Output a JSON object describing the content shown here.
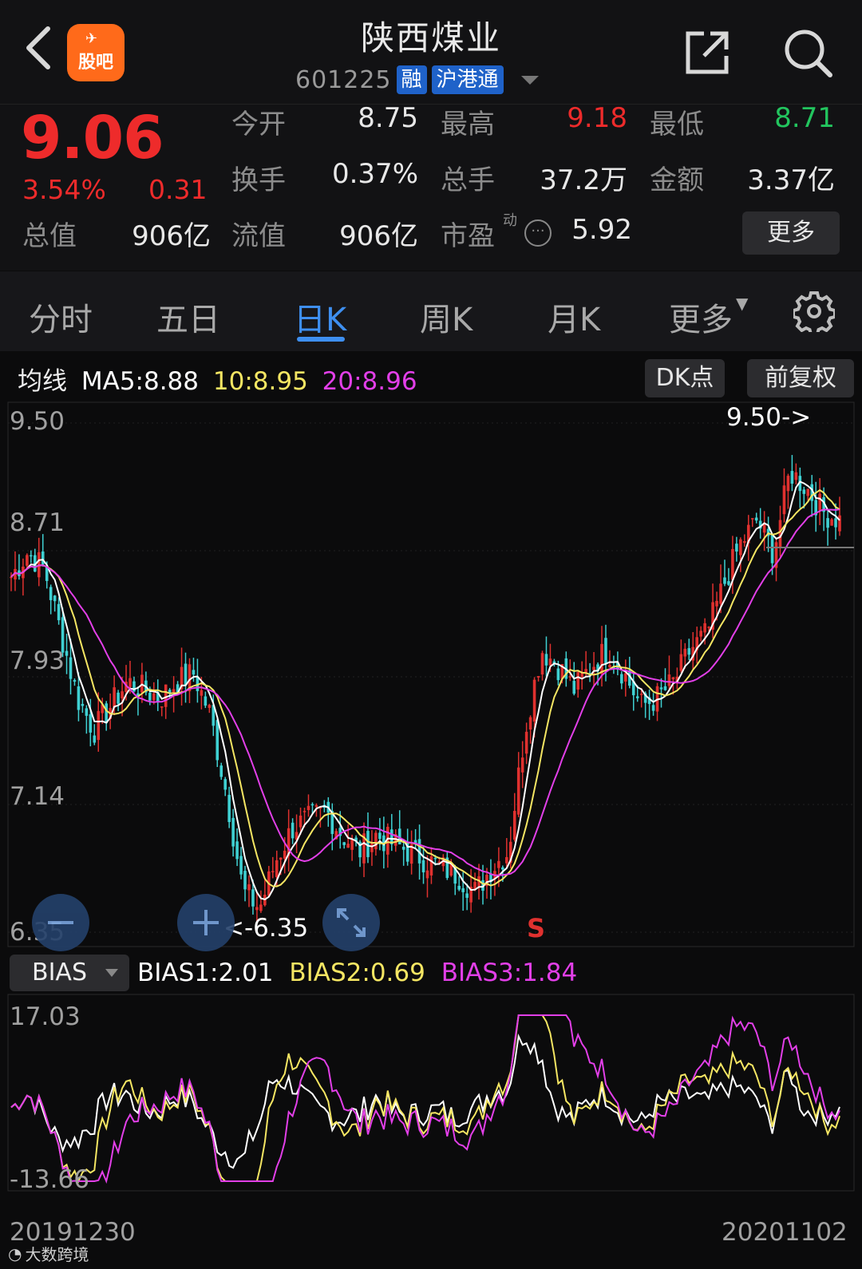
{
  "header": {
    "back_icon": "chevron-left-icon",
    "logo_text": "股吧",
    "stock_name": "陕西煤业",
    "stock_code": "601225",
    "tags": [
      "融",
      "沪港通"
    ],
    "share_icon": "share-icon",
    "search_icon": "search-icon"
  },
  "quote": {
    "price": "9.06",
    "change_pct": "3.54%",
    "change": "0.31",
    "rows": [
      [
        {
          "label": "今开",
          "value": "8.75",
          "color": "#e8e8e8"
        },
        {
          "label": "最高",
          "value": "9.18",
          "color": "#ee2b2b"
        },
        {
          "label": "最低",
          "value": "8.71",
          "color": "#22c55e"
        }
      ],
      [
        {
          "label": "换手",
          "value": "0.37%",
          "color": "#e8e8e8"
        },
        {
          "label": "总手",
          "value": "37.2万",
          "color": "#e8e8e8"
        },
        {
          "label": "金额",
          "value": "3.37亿",
          "color": "#e8e8e8"
        }
      ]
    ],
    "total_value_label": "总值",
    "total_value": "906亿",
    "float_value_label": "流值",
    "float_value": "906亿",
    "pe_label": "市盈",
    "pe_sup": "动",
    "pe_value": "5.92",
    "more_button": "更多"
  },
  "tabs": {
    "items": [
      "分时",
      "五日",
      "日K",
      "周K",
      "月K",
      "更多"
    ],
    "active": "日K",
    "settings_icon": "gear-icon"
  },
  "ma": {
    "label": "均线",
    "ma5": "MA5:8.88",
    "ma10": "10:8.95",
    "ma20": "20:8.96",
    "colors": {
      "ma5": "#ffffff",
      "ma10": "#f5e663",
      "ma20": "#e23fe8"
    },
    "dk_button": "DK点",
    "adjust_button": "前复权"
  },
  "chart_data": {
    "type": "candlestick",
    "y_labels": [
      "9.50",
      "8.71",
      "7.93",
      "7.14",
      "6.35"
    ],
    "ylim": [
      6.35,
      9.5
    ],
    "high_annotation": "9.50->",
    "low_annotation": "<-6.35",
    "signal": "S",
    "up_color": "#e0312f",
    "down_color": "#3fd0d2",
    "close_trend": [
      8.55,
      8.7,
      8.6,
      8.2,
      7.8,
      7.6,
      7.75,
      7.9,
      7.85,
      7.8,
      7.9,
      7.95,
      7.7,
      7.2,
      6.6,
      6.5,
      6.8,
      7.0,
      7.05,
      7.1,
      6.95,
      6.85,
      6.95,
      6.9,
      6.85,
      6.8,
      6.75,
      6.7,
      6.6,
      6.75,
      6.85,
      7.6,
      8.1,
      8.0,
      7.85,
      8.0,
      8.1,
      7.95,
      7.75,
      7.8,
      7.9,
      8.1,
      8.2,
      8.5,
      8.75,
      8.9,
      8.7,
      9.2,
      9.1,
      8.95,
      8.9
    ]
  },
  "bias": {
    "selector": "BIAS",
    "bias1": "BIAS1:2.01",
    "bias2": "BIAS2:0.69",
    "bias3": "BIAS3:1.84",
    "colors": {
      "b1": "#ffffff",
      "b2": "#f5e663",
      "b3": "#e23fe8"
    },
    "y_top": "17.03",
    "y_bottom": "-13.66"
  },
  "dates": {
    "start": "20191230",
    "end": "20201102"
  },
  "watermark": "大数跨境",
  "controls": {
    "zoom_out_icon": "minus-icon",
    "zoom_in_icon": "plus-icon",
    "fullscreen_icon": "expand-icon"
  }
}
